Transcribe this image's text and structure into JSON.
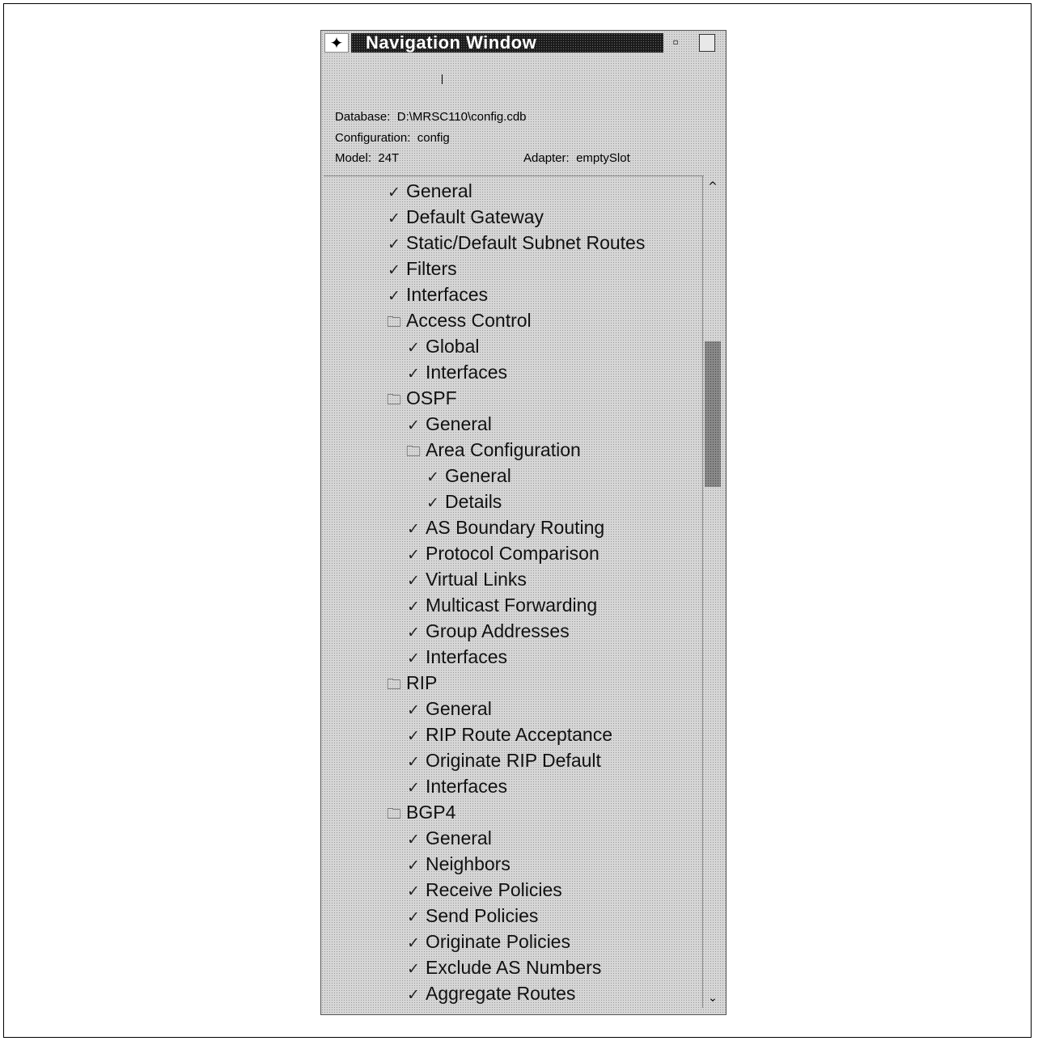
{
  "window": {
    "title": "Navigation Window",
    "sysmenu_glyph": "✦",
    "min_glyph": "▫",
    "max_glyph": ""
  },
  "info": {
    "database_label": "Database:",
    "database_value": "D:\\MRSC110\\config.cdb",
    "configuration_label": "Configuration:",
    "configuration_value": "config",
    "model_label": "Model:",
    "model_value": "24T",
    "adapter_label": "Adapter:",
    "adapter_value": "emptySlot"
  },
  "scrollbar": {
    "up_glyph": "^",
    "down_glyph": "⌄"
  },
  "icons": {
    "check": "✓",
    "folder": "🗀"
  },
  "tree": [
    {
      "label": "General",
      "icon": "check",
      "level": 0
    },
    {
      "label": "Default Gateway",
      "icon": "check",
      "level": 0
    },
    {
      "label": "Static/Default Subnet Routes",
      "icon": "check",
      "level": 0
    },
    {
      "label": "Filters",
      "icon": "check",
      "level": 0
    },
    {
      "label": "Interfaces",
      "icon": "check",
      "level": 0
    },
    {
      "label": "Access Control",
      "icon": "folder",
      "level": 0
    },
    {
      "label": "Global",
      "icon": "check",
      "level": 1
    },
    {
      "label": "Interfaces",
      "icon": "check",
      "level": 1
    },
    {
      "label": "OSPF",
      "icon": "folder",
      "level": 0
    },
    {
      "label": "General",
      "icon": "check",
      "level": 1
    },
    {
      "label": "Area Configuration",
      "icon": "folder",
      "level": 1
    },
    {
      "label": "General",
      "icon": "check",
      "level": 2
    },
    {
      "label": "Details",
      "icon": "check",
      "level": 2
    },
    {
      "label": "AS Boundary Routing",
      "icon": "check",
      "level": 1
    },
    {
      "label": "Protocol Comparison",
      "icon": "check",
      "level": 1
    },
    {
      "label": "Virtual Links",
      "icon": "check",
      "level": 1
    },
    {
      "label": "Multicast Forwarding",
      "icon": "check",
      "level": 1
    },
    {
      "label": "Group Addresses",
      "icon": "check",
      "level": 1
    },
    {
      "label": "Interfaces",
      "icon": "check",
      "level": 1
    },
    {
      "label": "RIP",
      "icon": "folder",
      "level": 0
    },
    {
      "label": "General",
      "icon": "check",
      "level": 1
    },
    {
      "label": "RIP Route Acceptance",
      "icon": "check",
      "level": 1
    },
    {
      "label": "Originate RIP Default",
      "icon": "check",
      "level": 1
    },
    {
      "label": "Interfaces",
      "icon": "check",
      "level": 1
    },
    {
      "label": "BGP4",
      "icon": "folder",
      "level": 0
    },
    {
      "label": "General",
      "icon": "check",
      "level": 1
    },
    {
      "label": "Neighbors",
      "icon": "check",
      "level": 1
    },
    {
      "label": "Receive Policies",
      "icon": "check",
      "level": 1
    },
    {
      "label": "Send Policies",
      "icon": "check",
      "level": 1
    },
    {
      "label": "Originate Policies",
      "icon": "check",
      "level": 1
    },
    {
      "label": "Exclude AS Numbers",
      "icon": "check",
      "level": 1
    },
    {
      "label": "Aggregate Routes",
      "icon": "check",
      "level": 1
    }
  ]
}
